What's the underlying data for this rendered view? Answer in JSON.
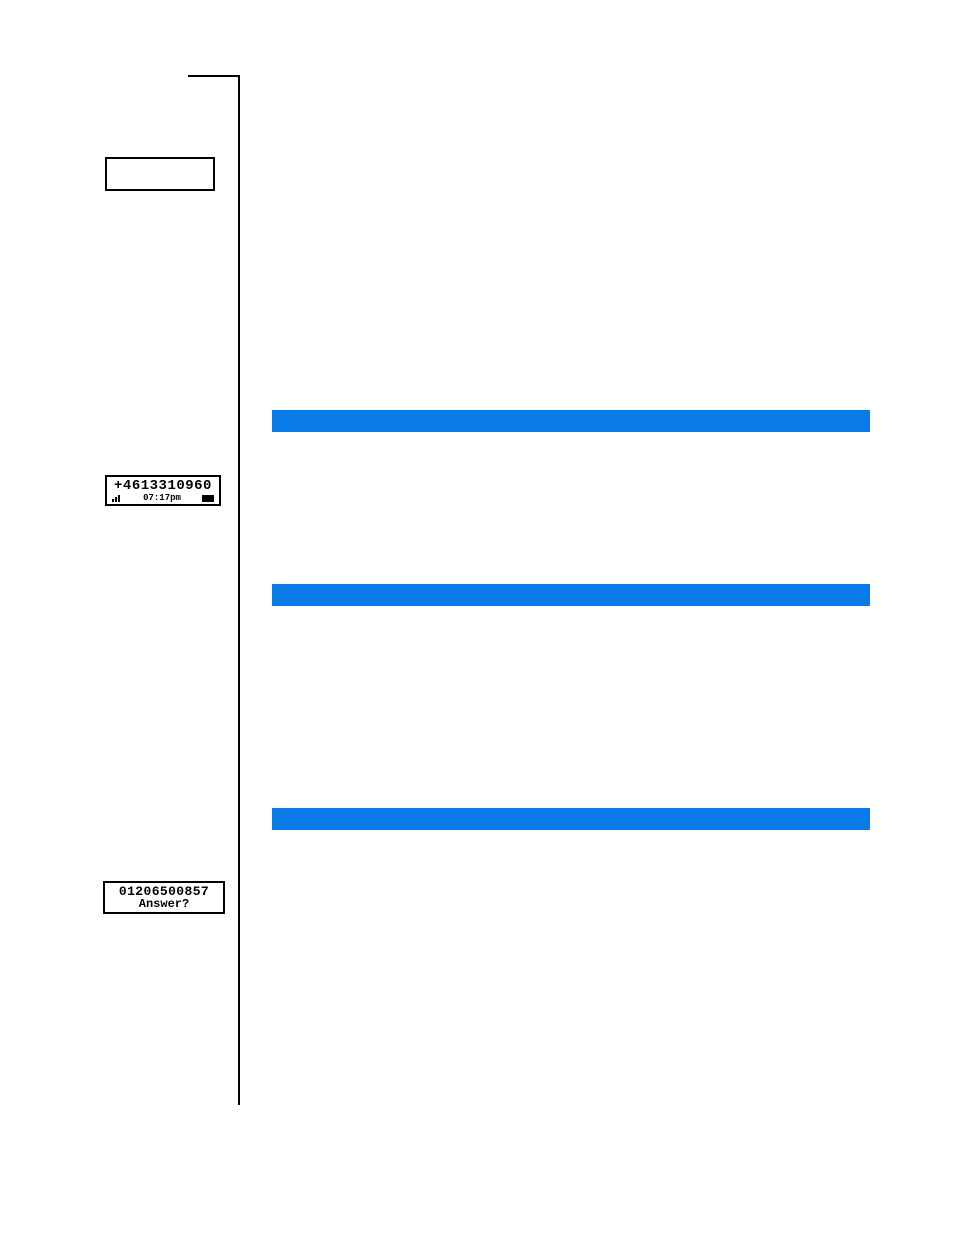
{
  "sidebar": {
    "lcd_empty": "",
    "lcd_number": {
      "number": "+4613310960",
      "time": "07:17pm"
    },
    "lcd_answer": {
      "number": "01206500857",
      "prompt": "Answer?"
    }
  }
}
